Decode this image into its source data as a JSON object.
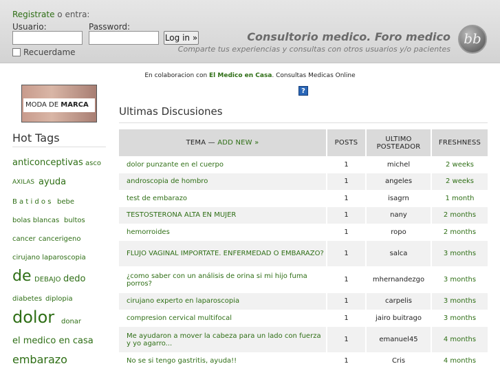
{
  "header": {
    "register_link": "Registrate",
    "register_suffix": " o entra:",
    "username_label": "Usuario:",
    "password_label": "Password:",
    "login_button": "Log in »",
    "remember_label": "Recuerdame",
    "site_title": "Consultorio medico. Foro medico",
    "site_subtitle": "Comparte tus experiencias y consultas con otros usuarios y/o pacientes",
    "logo_text": "bb"
  },
  "collab": {
    "prefix": "En colaboracion con ",
    "link": "El Medico en Casa",
    "suffix": ". Consultas Medicas Online"
  },
  "banner": {
    "text_prefix": "MODA DE ",
    "text_bold": "MARCA"
  },
  "sidebar": {
    "hot_tags_title": "Hot Tags",
    "tags": [
      "anticonceptivas",
      "asco",
      "AXILAS",
      "ayuda",
      "B a t i d o s",
      "bebe",
      "bolas blancas",
      "bultos",
      "cancer",
      "cancerigeno",
      "cirujano laparoscopia",
      "de",
      "DEBAJO",
      "dedo",
      "diabetes",
      "diplopia",
      "dolor",
      "donar",
      "el medico en casa",
      "embarazo"
    ]
  },
  "main": {
    "title": "Ultimas Discusiones",
    "columns": {
      "topic": "TEMA — ",
      "add_new": "ADD NEW »",
      "posts": "POSTS",
      "last_poster": "ULTIMO POSTEADOR",
      "freshness": "FRESHNESS"
    },
    "rows": [
      {
        "topic": "dolor punzante en el cuerpo",
        "posts": "1",
        "poster": "michel",
        "fresh": "2 weeks"
      },
      {
        "topic": "androscopia de hombro",
        "posts": "1",
        "poster": "angeles",
        "fresh": "2 weeks"
      },
      {
        "topic": "test de embarazo",
        "posts": "1",
        "poster": "isagrn",
        "fresh": "1 month"
      },
      {
        "topic": "TESTOSTERONA ALTA EN MUJER",
        "posts": "1",
        "poster": "nany",
        "fresh": "2 months"
      },
      {
        "topic": "hemorroides",
        "posts": "1",
        "poster": "ropo",
        "fresh": "2 months"
      },
      {
        "topic": "FLUJO VAGINAL IMPORTATE. ENFERMEDAD O EMBARAZO?",
        "posts": "1",
        "poster": "salca",
        "fresh": "3 months"
      },
      {
        "topic": "¿como saber con un análisis de orina si mi hijo fuma porros?",
        "posts": "1",
        "poster": "mhernandezgo",
        "fresh": "3 months"
      },
      {
        "topic": "cirujano experto en laparoscopia",
        "posts": "1",
        "poster": "carpelis",
        "fresh": "3 months"
      },
      {
        "topic": "compresion cervical multifocal",
        "posts": "1",
        "poster": "jairo buitrago",
        "fresh": "3 months"
      },
      {
        "topic": "Me ayudaron a mover la cabeza para un lado con fuerza y yo agarro...",
        "posts": "1",
        "poster": "emanuel45",
        "fresh": "4 months"
      },
      {
        "topic": "No se si tengo gastritis, ayuda!!",
        "posts": "1",
        "poster": "Cris",
        "fresh": "4 months"
      }
    ]
  }
}
